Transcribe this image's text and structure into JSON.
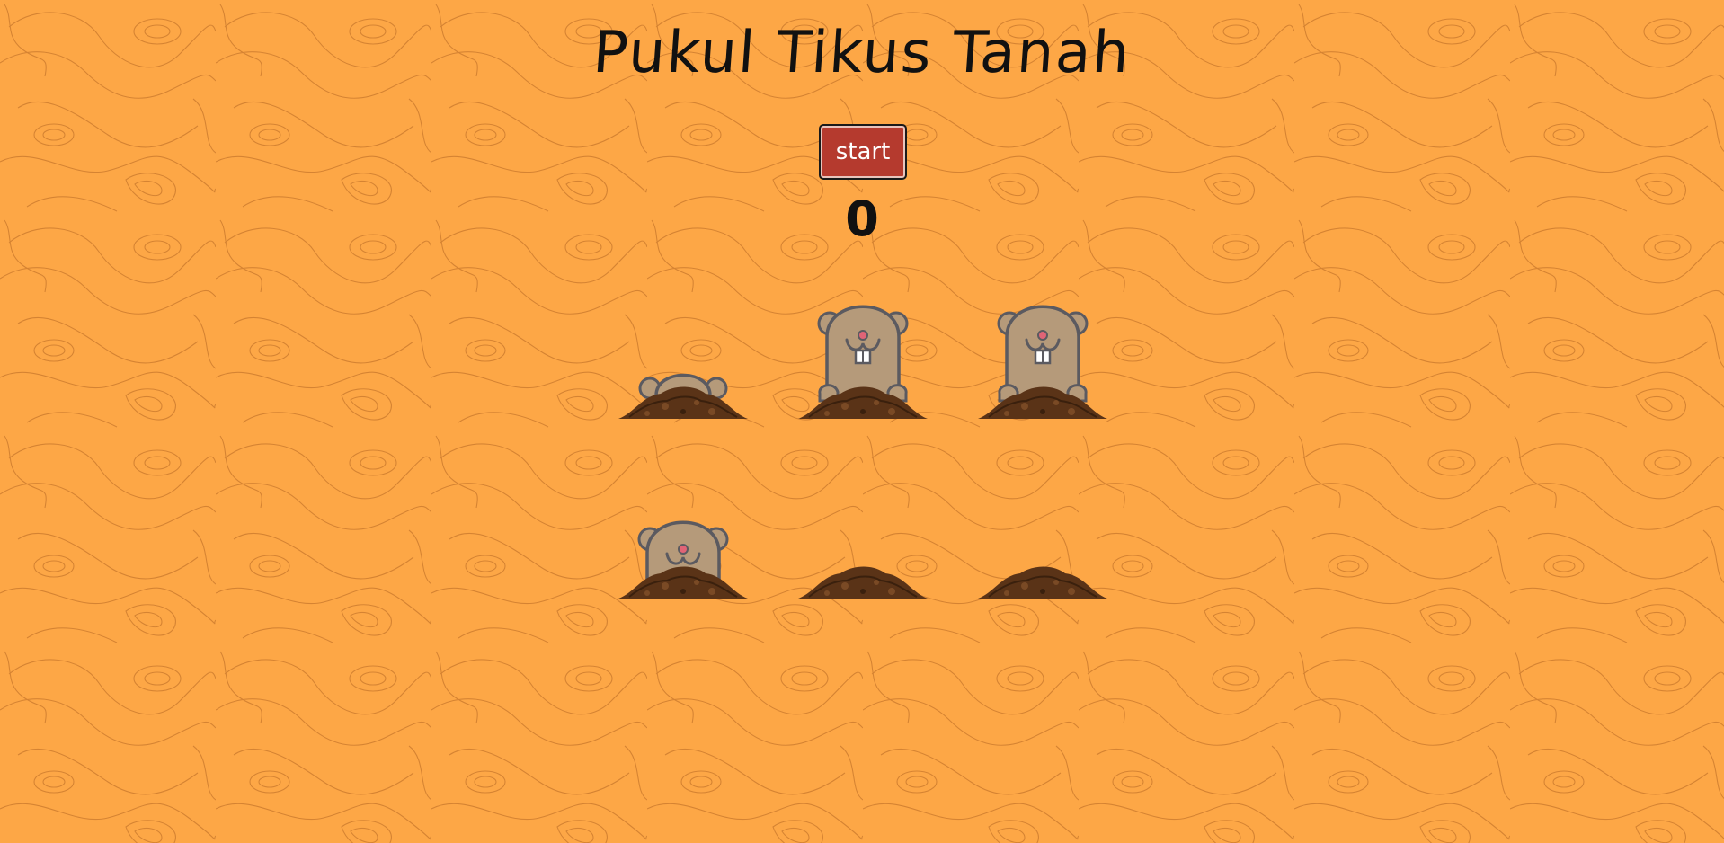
{
  "game": {
    "title": "Pukul Tikus Tanah",
    "start_label": "start",
    "score": "0"
  },
  "holes": [
    {
      "id": 1,
      "mole_state": "peeking"
    },
    {
      "id": 2,
      "mole_state": "up"
    },
    {
      "id": 3,
      "mole_state": "up"
    },
    {
      "id": 4,
      "mole_state": "half"
    },
    {
      "id": 5,
      "mole_state": "hidden"
    },
    {
      "id": 6,
      "mole_state": "hidden"
    }
  ],
  "colors": {
    "background": "#fda746",
    "pattern_line": "#c9772a",
    "button": "#b53a2e",
    "mole_body": "#b59a7a",
    "mole_outline": "#5b5a60",
    "nose": "#e06476",
    "dirt": "#5a3317"
  }
}
